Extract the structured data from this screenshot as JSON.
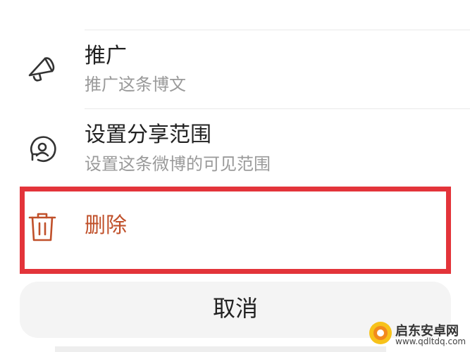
{
  "menu": {
    "items": [
      {
        "title": "推广",
        "subtitle": "推广这条博文",
        "icon": "megaphone-icon"
      },
      {
        "title": "设置分享范围",
        "subtitle": "设置这条微博的可见范围",
        "icon": "share-scope-icon"
      }
    ],
    "delete": {
      "label": "删除",
      "icon": "trash-icon",
      "color": "#c0502a"
    },
    "highlight_color": "#e3343a"
  },
  "cancel": {
    "label": "取消"
  },
  "watermark": {
    "name": "启东安卓网",
    "url": "www.qdltdq.com"
  }
}
